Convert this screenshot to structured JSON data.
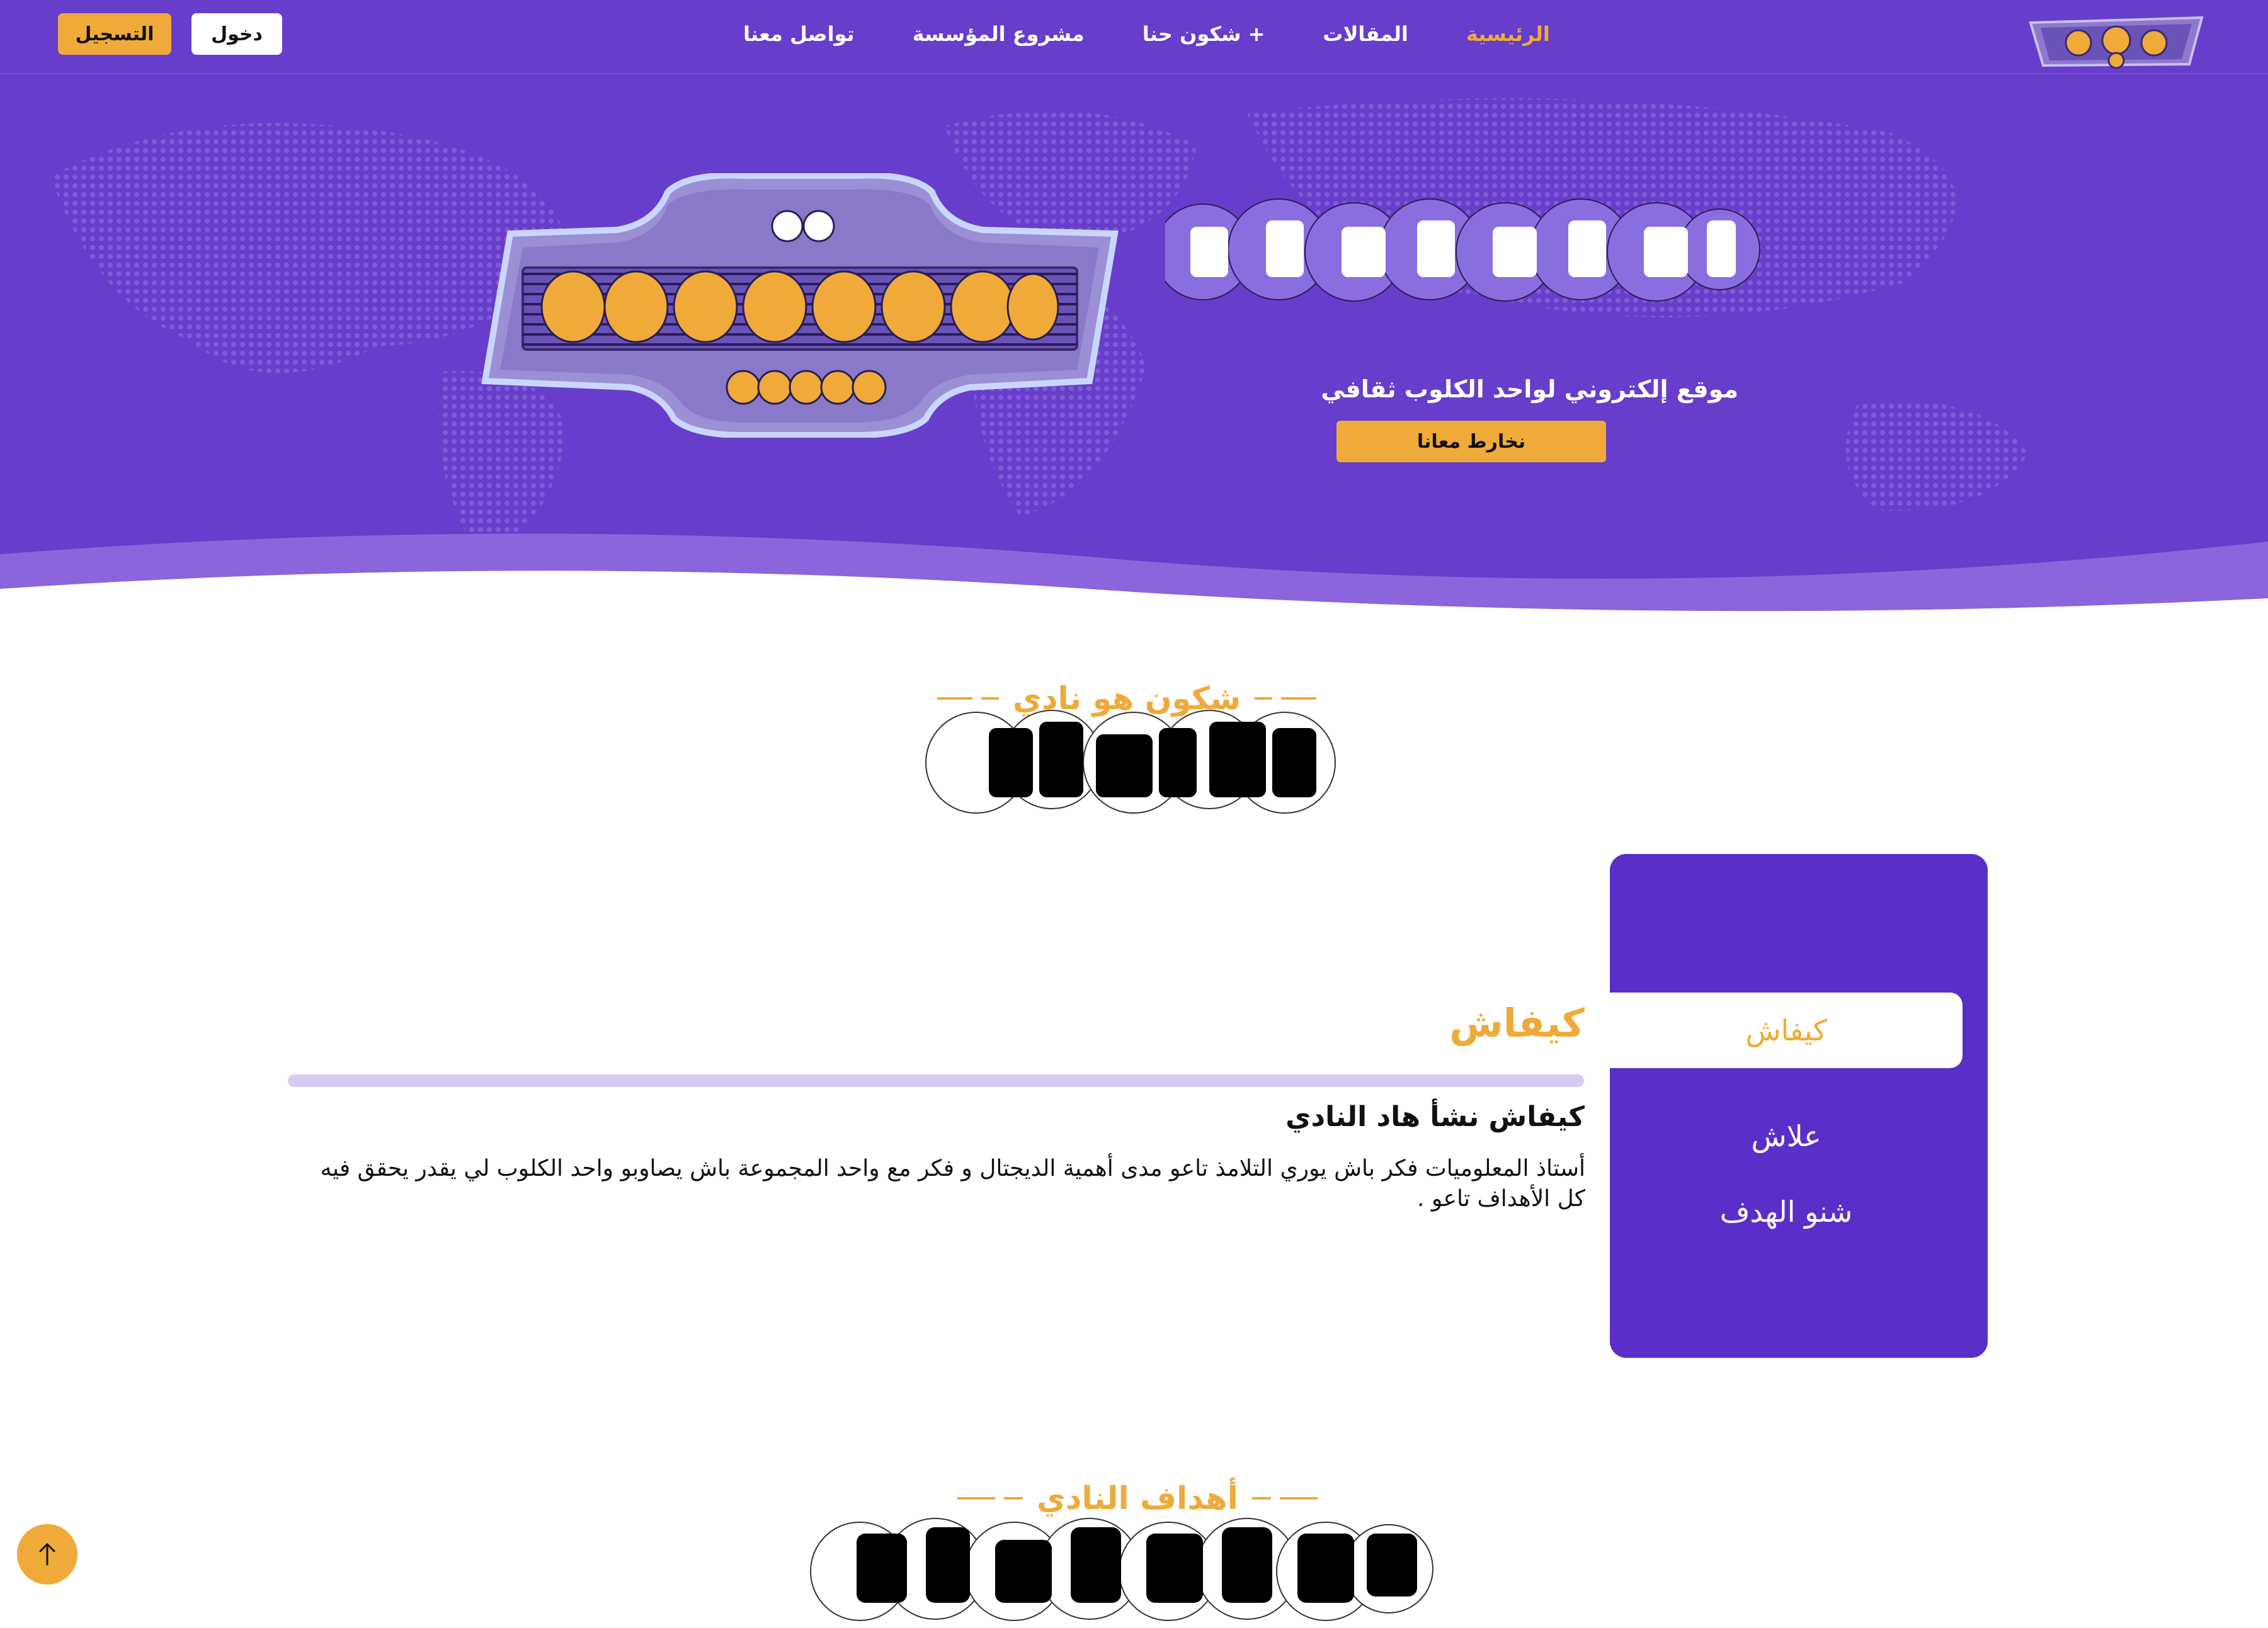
{
  "colors": {
    "brand_purple": "#673dcb",
    "panel_purple": "#5a2fc9",
    "accent_gold": "#efaa39",
    "bar_lavender": "#d6cbf3"
  },
  "nav": {
    "links": [
      {
        "label": "الرئيسية",
        "active": true
      },
      {
        "label": "المقالات",
        "active": false
      },
      {
        "label": "شكون حنا +",
        "active": false
      },
      {
        "label": "مشروع المؤسسة",
        "active": false
      },
      {
        "label": "تواصل معنا",
        "active": false
      }
    ],
    "login_label": "دخول",
    "register_label": "التسجيل",
    "logo_icon": "club-logo-icon"
  },
  "hero": {
    "subtitle": "موقع إلكتروني لواحد الكلوب ثقافي",
    "cta_label": "نخارط معانا",
    "badge_icon": "club-badge-icon"
  },
  "about": {
    "eyebrow": "شكون هو نادي",
    "tabs": [
      {
        "label": "كيفاش",
        "active": true
      },
      {
        "label": "علاش",
        "active": false
      },
      {
        "label": "شنو الهدف",
        "active": false
      }
    ],
    "content_title": "كيفاش",
    "content_subtitle": "كيفاش نشأ هاد النادي",
    "content_body": "أستاذ المعلوميات فكر باش يوري التلامذ تاعو مدى أهمية الديجتال و فكر مع واحد المجموعة باش يصاوبو واحد الكلوب لي يقدر يحقق فيه كل الأهداف تاعو ."
  },
  "goals": {
    "eyebrow": "أهداف النادي"
  },
  "scroll_top_icon": "arrow-up-icon"
}
